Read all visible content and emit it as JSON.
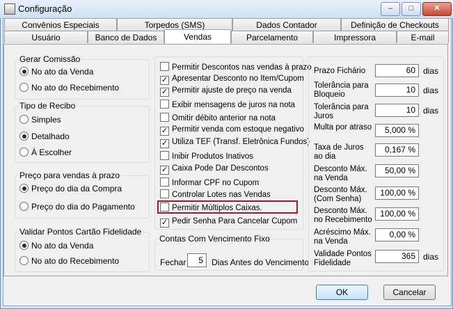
{
  "window": {
    "title": "Configuração",
    "controls": {
      "minimize": "–",
      "maximize": "□",
      "close": "✕"
    }
  },
  "tabs_row1": [
    "Convênios Especiais",
    "Torpedos (SMS)",
    "Dados Contador",
    "Definição de Checkouts"
  ],
  "tabs_row2": [
    "Usuário",
    "Banco de Dados",
    "Vendas",
    "Parcelamento",
    "Impressora",
    "E-mail"
  ],
  "active_tab": "Vendas",
  "gerar_comissao": {
    "title": "Gerar Comissão",
    "options": [
      "No ato da Venda",
      "No ato do Recebimento"
    ],
    "selected": 0
  },
  "tipo_recibo": {
    "title": "Tipo de Recibo",
    "options": [
      "Simples",
      "Detalhado",
      "À Escolher"
    ],
    "selected": 1
  },
  "preco_prazo": {
    "title": "Preço para vendas à prazo",
    "options": [
      "Preço do dia da Compra",
      "Preço do dia do Pagamento"
    ],
    "selected": 0
  },
  "validar_pontos": {
    "title": "Validar Pontos Cartão Fidelidade",
    "options": [
      "No ato da Venda",
      "No ato do Recebimento"
    ],
    "selected": 0
  },
  "checkboxes": [
    {
      "label": "Permitir Descontos nas vendas à prazo",
      "checked": false
    },
    {
      "label": "Apresentar Desconto no Item/Cupom",
      "checked": true
    },
    {
      "label": "Permitir ajuste de preço na venda",
      "checked": true
    },
    {
      "label": "Exibir mensagens de juros na nota",
      "checked": false
    },
    {
      "label": "Omitir débito anterior na nota",
      "checked": false
    },
    {
      "label": "Permitir venda com estoque negativo",
      "checked": true
    },
    {
      "label": "Utiliza TEF (Transf. Eletrônica Fundos)",
      "checked": true
    },
    {
      "label": "Inibir Produtos Inativos",
      "checked": false
    },
    {
      "label": "Caixa Pode Dar Descontos",
      "checked": true
    },
    {
      "label": "Informar CPF no Cupom",
      "checked": false
    },
    {
      "label": "Controlar Lotes nas Vendas",
      "checked": false
    },
    {
      "label": "Permitir Múltiplos Caixas.",
      "checked": false
    },
    {
      "label": "Pedir Senha Para Cancelar Cupom",
      "checked": true
    }
  ],
  "contas_vencimento": {
    "title": "Contas Com Vencimento Fixo",
    "prefix": "Fechar",
    "value": "5",
    "suffix": "Dias Antes do Vencimento"
  },
  "fields": [
    {
      "label": "Prazo Fichário",
      "value": "60",
      "unit": "dias"
    },
    {
      "label": "Tolerância para Bloqueio",
      "value": "10",
      "unit": "dias"
    },
    {
      "label": "Tolerância para Juros",
      "value": "10",
      "unit": "dias"
    },
    {
      "label": "Multa por atraso",
      "value": "5,000 %",
      "unit": ""
    },
    {
      "label": "Taxa de Juros ao dia",
      "value": "0,167 %",
      "unit": ""
    },
    {
      "label": "Desconto Máx. na Venda",
      "value": "50,00 %",
      "unit": ""
    },
    {
      "label": "Desconto Máx. (Com Senha)",
      "value": "100,00 %",
      "unit": ""
    },
    {
      "label": "Desconto Máx. no Recebimento",
      "value": "100,00 %",
      "unit": ""
    },
    {
      "label": "Acréscimo Máx. na Venda",
      "value": "0,00 %",
      "unit": ""
    },
    {
      "label": "Validade Pontos Fidelidade",
      "value": "365",
      "unit": "dias"
    }
  ],
  "buttons": {
    "ok": "OK",
    "cancel": "Cancelar"
  },
  "colors": {
    "highlight": "#a0191e",
    "ok_border": "#3c7fb1"
  }
}
